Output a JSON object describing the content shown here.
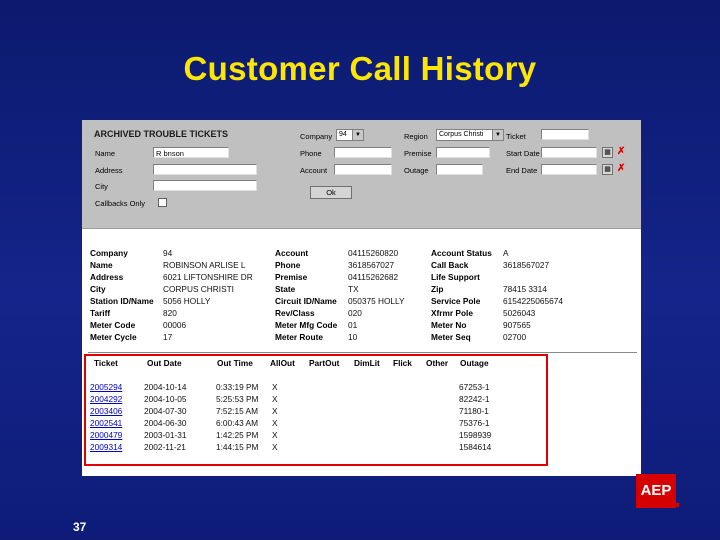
{
  "slide": {
    "title": "Customer Call History",
    "page_number": "37",
    "logo": "AEP",
    "logo_color": "#d70000"
  },
  "form": {
    "title": "ARCHIVED TROUBLE TICKETS",
    "name": {
      "label": "Name",
      "value": "R bnson"
    },
    "address": {
      "label": "Address",
      "value": ""
    },
    "city": {
      "label": "City",
      "value": ""
    },
    "callbacks_only": {
      "label": "Callbacks Only",
      "checked": false
    },
    "company": {
      "label": "Company",
      "selected": "94"
    },
    "phone": {
      "label": "Phone",
      "value": ""
    },
    "account": {
      "label": "Account",
      "value": ""
    },
    "region": {
      "label": "Region",
      "selected": "Corpus Christi"
    },
    "premise": {
      "label": "Premise",
      "value": ""
    },
    "outage": {
      "label": "Outage",
      "value": ""
    },
    "ticket": {
      "label": "Ticket",
      "value": ""
    },
    "start_date": {
      "label": "Start Date",
      "value": ""
    },
    "end_date": {
      "label": "End Date",
      "value": ""
    },
    "ok_label": "Ok",
    "calendar_icon": "calendar-icon",
    "clear_icon": "clear-x-icon",
    "clear_symbol": "✗",
    "accent_color": "#e00000"
  },
  "details": {
    "col1": [
      {
        "label": "Company",
        "value": "94"
      },
      {
        "label": "Name",
        "value": "ROBINSON ARLISE L"
      },
      {
        "label": "Address",
        "value": "6021 LIFTONSHIRE DR"
      },
      {
        "label": "City",
        "value": "CORPUS CHRISTI"
      },
      {
        "label": "Station ID/Name",
        "value": "5056 HOLLY"
      },
      {
        "label": "Tariff",
        "value": "820"
      },
      {
        "label": "Meter Code",
        "value": "00006"
      },
      {
        "label": "Meter Cycle",
        "value": "17"
      }
    ],
    "col2": [
      {
        "label": "Account",
        "value": "04115260820"
      },
      {
        "label": "Phone",
        "value": "3618567027"
      },
      {
        "label": "Premise",
        "value": "04115262682"
      },
      {
        "label": "State",
        "value": "TX"
      },
      {
        "label": "Circuit ID/Name",
        "value": "050375 HOLLY"
      },
      {
        "label": "Rev/Class",
        "value": "020"
      },
      {
        "label": "Meter Mfg Code",
        "value": "01"
      },
      {
        "label": "Meter Route",
        "value": "10"
      }
    ],
    "col3": [
      {
        "label": "Account Status",
        "value": "A"
      },
      {
        "label": "Call Back",
        "value": "3618567027"
      },
      {
        "label": "Life Support",
        "value": ""
      },
      {
        "label": "Zip",
        "value": "78415 3314"
      },
      {
        "label": "Service Pole",
        "value": "6154225065674"
      },
      {
        "label": "Xfrmr Pole",
        "value": "5026043"
      },
      {
        "label": "Meter No",
        "value": "907565"
      },
      {
        "label": "Meter Seq",
        "value": "02700"
      }
    ]
  },
  "history": {
    "columns": [
      "Ticket",
      "Out Date",
      "Out Time",
      "AllOut",
      "PartOut",
      "DimLit",
      "Flick",
      "Other",
      "Outage"
    ],
    "rows": [
      {
        "ticket": "2005294",
        "date": "2004-10-14",
        "time": "0:33:19 PM",
        "allout": "X",
        "outage": "67253-1"
      },
      {
        "ticket": "2004292",
        "date": "2004-10-05",
        "time": "5:25:53 PM",
        "allout": "X",
        "outage": "82242-1"
      },
      {
        "ticket": "2003406",
        "date": "2004-07-30",
        "time": "7:52:15 AM",
        "allout": "X",
        "outage": "71180-1"
      },
      {
        "ticket": "2002541",
        "date": "2004-06-30",
        "time": "6:00:43 AM",
        "allout": "X",
        "outage": "75376-1"
      },
      {
        "ticket": "2000479",
        "date": "2003-01-31",
        "time": "1:42:25 PM",
        "allout": "X",
        "outage": "1598939"
      },
      {
        "ticket": "2009314",
        "date": "2002-11-21",
        "time": "1:44:15 PM",
        "allout": "X",
        "outage": "1584614"
      }
    ]
  }
}
